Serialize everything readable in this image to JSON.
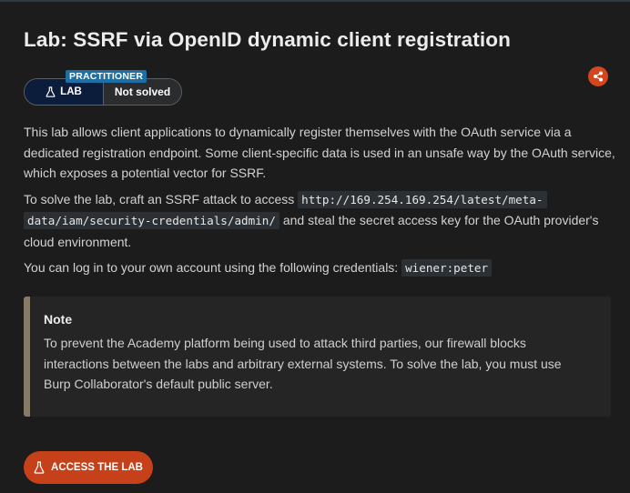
{
  "lab": {
    "title": "Lab: SSRF via OpenID dynamic client registration",
    "level": "PRACTITIONER",
    "type_label": "LAB",
    "status": "Not solved"
  },
  "description": {
    "p1": "This lab allows client applications to dynamically register themselves with the OAuth service via a dedicated registration endpoint. Some client-specific data is used in an unsafe way by the OAuth service, which exposes a potential vector for SSRF.",
    "p2_before": "To solve the lab, craft an SSRF attack to access ",
    "p2_code": "http://169.254.169.254/latest/meta-data/iam/security-credentials/admin/",
    "p2_after": " and steal the secret access key for the OAuth provider's cloud environment.",
    "p3_before": "You can log in to your own account using the following credentials: ",
    "p3_code": "wiener:peter"
  },
  "note": {
    "title": "Note",
    "body": "To prevent the Academy platform being used to attack third parties, our firewall blocks interactions between the labs and arbitrary external systems. To solve the lab, you must use Burp Collaborator's default public server."
  },
  "access_button": {
    "label": "ACCESS THE LAB"
  },
  "icons": {
    "share": "share-icon",
    "flask": "flask-icon"
  },
  "colors": {
    "background": "#1c1c1c",
    "accent_orange": "#c6401a",
    "badge_lab_bg": "#0c1d3b",
    "badge_level_bg": "#1d6fa5",
    "note_border": "#857b68"
  }
}
